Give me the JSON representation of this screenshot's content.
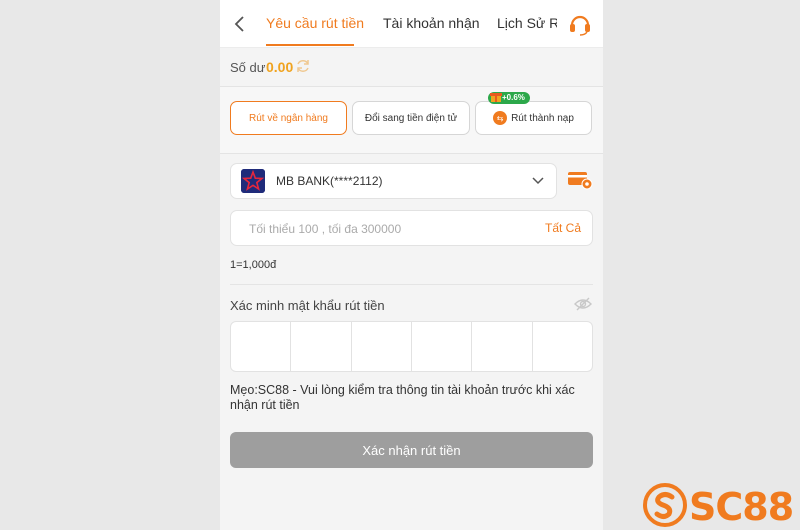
{
  "header": {
    "tabs": [
      {
        "label": "Yêu cầu rút tiền",
        "active": true
      },
      {
        "label": "Tài khoản nhận",
        "active": false
      },
      {
        "label": "Lịch Sử Rú",
        "active": false
      }
    ],
    "back_icon": "chevron-left-icon",
    "support_icon": "headset-icon"
  },
  "balance": {
    "label": "Số dư",
    "value": "0.00",
    "refresh_icon": "refresh-icon"
  },
  "methods": [
    {
      "label": "Rút về ngân hàng",
      "selected": true
    },
    {
      "label": "Đổi sang tiền điện tử",
      "selected": false
    },
    {
      "label": "Rút thành nạp",
      "selected": false
    }
  ],
  "bonus_badge": "+0.6%",
  "bank": {
    "name": "MB BANK(****2112)",
    "logo_icon": "mb-bank-star-icon"
  },
  "amount": {
    "placeholder": "Tối thiểu 100 , tối đa 300000",
    "value": "",
    "all_label": "Tất Cả"
  },
  "rate": "1=1,000đ",
  "password": {
    "label": "Xác minh mật khẩu rút tiền",
    "cells": 6
  },
  "tip": "Mẹo:SC88 - Vui lòng kiểm tra thông tin tài khoản trước khi xác nhận rút tiền",
  "confirm_label": "Xác nhận rút tiền",
  "brand": {
    "text": "SC88"
  },
  "colors": {
    "accent": "#f07b1f",
    "balance": "#f0a31f",
    "bonus": "#2ca84a",
    "disabled_button": "#9e9e9e"
  }
}
